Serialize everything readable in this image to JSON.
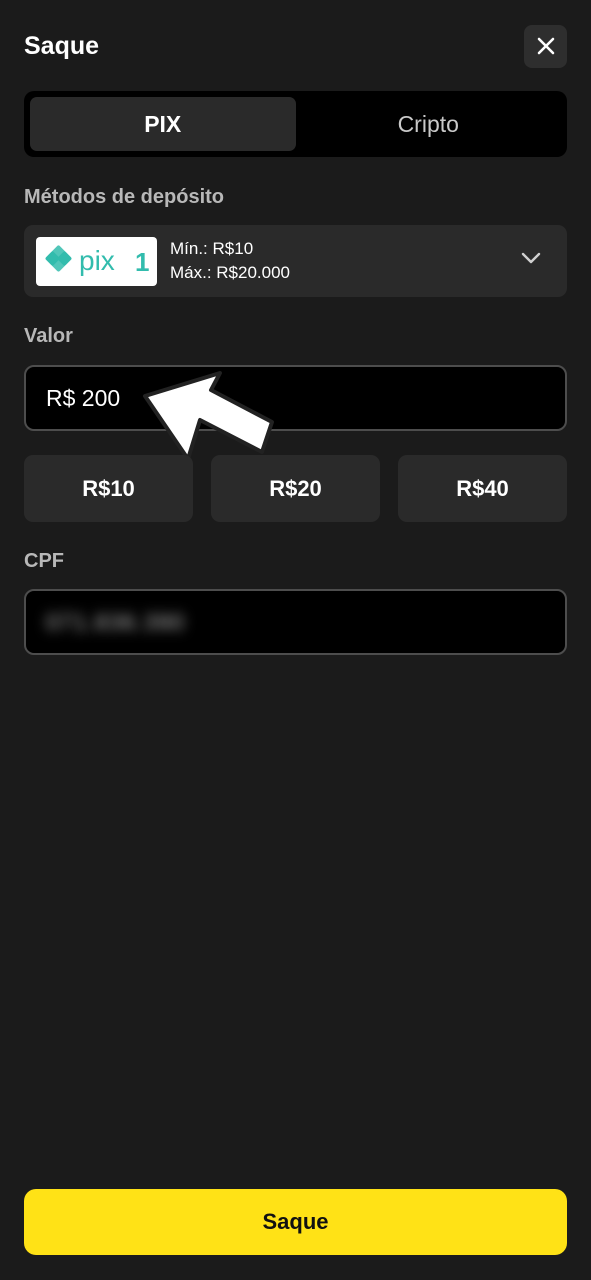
{
  "header": {
    "title": "Saque",
    "close_icon": "close-icon"
  },
  "tabs": [
    {
      "label": "PIX",
      "active": true
    },
    {
      "label": "Cripto",
      "active": false
    }
  ],
  "deposit_methods": {
    "label": "Métodos de depósito",
    "selected": {
      "logo_icon": "pix-logo",
      "logo_text": "pix",
      "min": "Mín.: R$10",
      "max": "Máx.: R$20.000"
    }
  },
  "amount": {
    "label": "Valor",
    "value": "R$ 200",
    "quick_values": [
      "R$10",
      "R$20",
      "R$40"
    ]
  },
  "cpf": {
    "label": "CPF",
    "value": "071.836.390"
  },
  "submit_label": "Saque",
  "colors": {
    "background": "#1b1b1b",
    "accent": "#ffe216",
    "pix_teal": "#32bcad"
  }
}
